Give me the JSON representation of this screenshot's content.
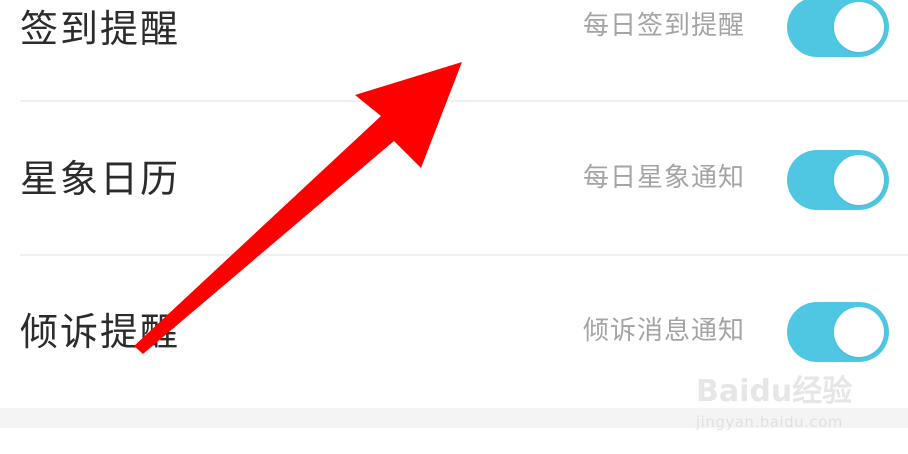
{
  "settings": {
    "items": [
      {
        "title": "签到提醒",
        "description": "每日签到提醒",
        "enabled": true
      },
      {
        "title": "星象日历",
        "description": "每日星象通知",
        "enabled": true
      },
      {
        "title": "倾诉提醒",
        "description": "倾诉消息通知",
        "enabled": true
      }
    ]
  },
  "colors": {
    "toggle_on": "#4fc7e2",
    "arrow": "#ff0000",
    "title_text": "#2b2b2b",
    "desc_text": "#a4a4a4"
  },
  "watermark": {
    "brand": "Baidu经验",
    "url": "jingyan.baidu.com"
  }
}
